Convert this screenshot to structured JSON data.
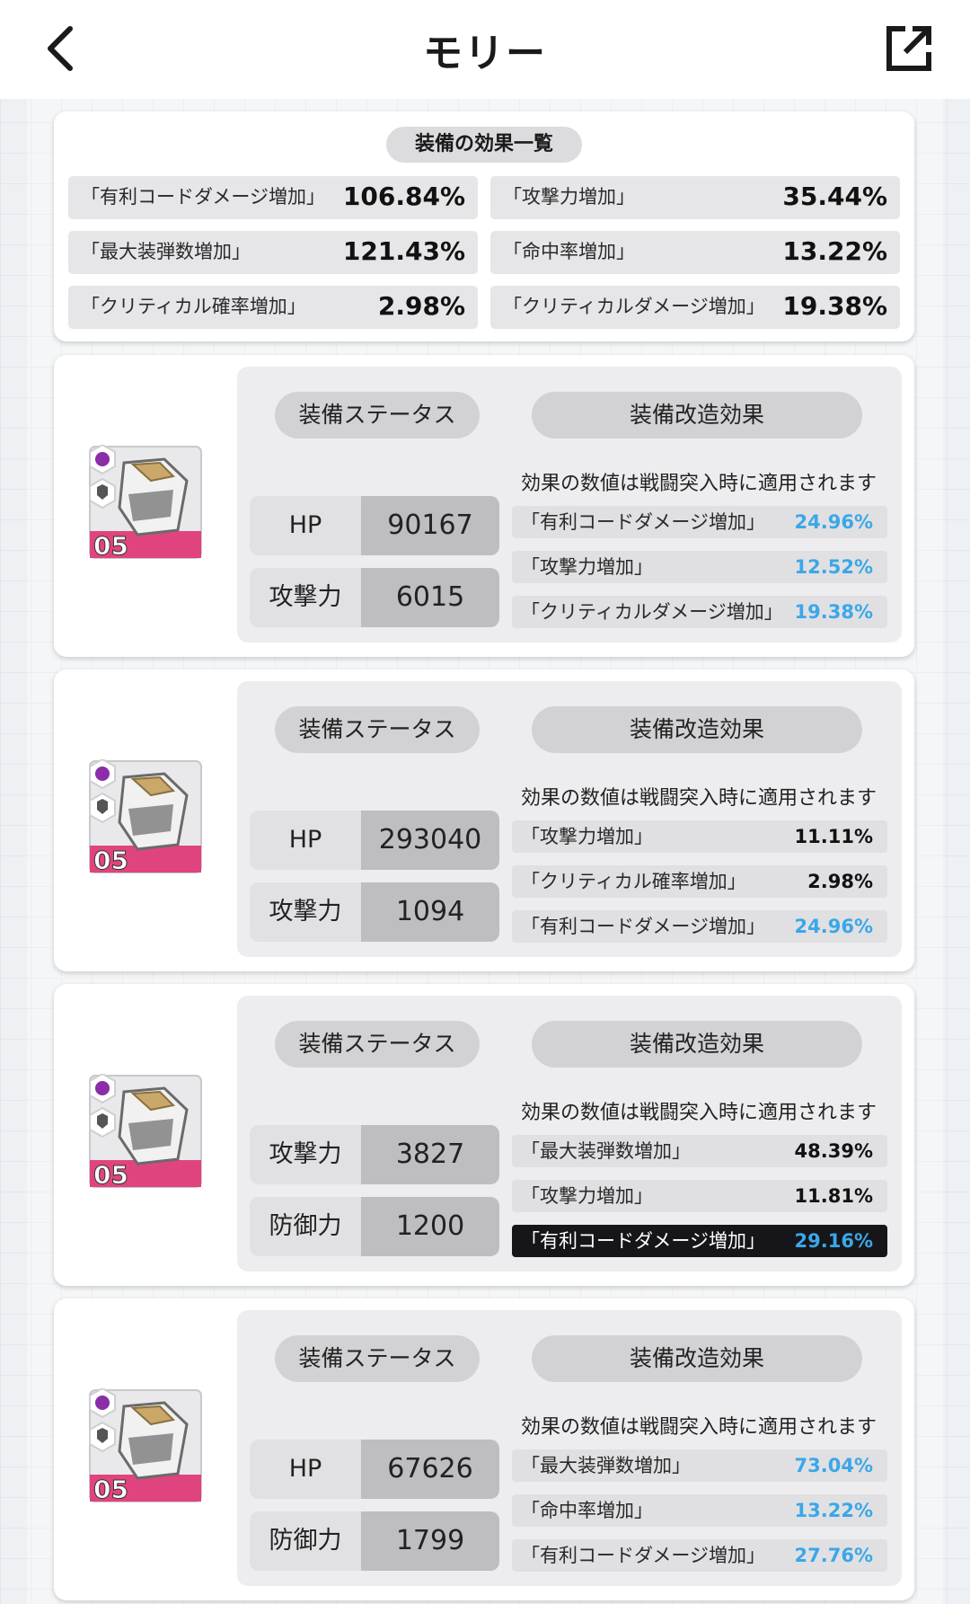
{
  "header": {
    "title": "モリー"
  },
  "summary": {
    "title": "装備の効果一覧",
    "items": [
      {
        "label": "「有利コードダメージ増加」",
        "value": "106.84%"
      },
      {
        "label": "「攻撃力増加」",
        "value": "35.44%"
      },
      {
        "label": "「最大装弾数増加」",
        "value": "121.43%"
      },
      {
        "label": "「命中率増加」",
        "value": "13.22%"
      },
      {
        "label": "「クリティカル確率増加」",
        "value": "2.98%"
      },
      {
        "label": "「クリティカルダメージ増加」",
        "value": "19.38%"
      }
    ]
  },
  "colors": {
    "accent_blue": "#3ba7e8",
    "badge_purple": "#8b2ca8",
    "level_pink": "#e0447e"
  },
  "equipment": [
    {
      "level": "05",
      "status_label": "装備ステータス",
      "mod_label": "装備改造効果",
      "note": "効果の数値は戦闘突入時に適用されます",
      "stats": [
        {
          "key": "HP",
          "value": "90167"
        },
        {
          "key": "攻撃力",
          "value": "6015"
        }
      ],
      "effects": [
        {
          "label": "「有利コードダメージ増加」",
          "value": "24.96%",
          "highlight": "blue"
        },
        {
          "label": "「攻撃力増加」",
          "value": "12.52%",
          "highlight": "blue"
        },
        {
          "label": "「クリティカルダメージ増加」",
          "value": "19.38%",
          "highlight": "blue"
        }
      ]
    },
    {
      "level": "05",
      "status_label": "装備ステータス",
      "mod_label": "装備改造効果",
      "note": "効果の数値は戦闘突入時に適用されます",
      "stats": [
        {
          "key": "HP",
          "value": "293040"
        },
        {
          "key": "攻撃力",
          "value": "1094"
        }
      ],
      "effects": [
        {
          "label": "「攻撃力増加」",
          "value": "11.11%",
          "highlight": "none"
        },
        {
          "label": "「クリティカル確率増加」",
          "value": "2.98%",
          "highlight": "none"
        },
        {
          "label": "「有利コードダメージ増加」",
          "value": "24.96%",
          "highlight": "blue"
        }
      ]
    },
    {
      "level": "05",
      "status_label": "装備ステータス",
      "mod_label": "装備改造効果",
      "note": "効果の数値は戦闘突入時に適用されます",
      "stats": [
        {
          "key": "攻撃力",
          "value": "3827"
        },
        {
          "key": "防御力",
          "value": "1200"
        }
      ],
      "effects": [
        {
          "label": "「最大装弾数増加」",
          "value": "48.39%",
          "highlight": "none"
        },
        {
          "label": "「攻撃力増加」",
          "value": "11.81%",
          "highlight": "none"
        },
        {
          "label": "「有利コードダメージ増加」",
          "value": "29.16%",
          "highlight": "dark"
        }
      ]
    },
    {
      "level": "05",
      "status_label": "装備ステータス",
      "mod_label": "装備改造効果",
      "note": "効果の数値は戦闘突入時に適用されます",
      "stats": [
        {
          "key": "HP",
          "value": "67626"
        },
        {
          "key": "防御力",
          "value": "1799"
        }
      ],
      "effects": [
        {
          "label": "「最大装弾数増加」",
          "value": "73.04%",
          "highlight": "blue"
        },
        {
          "label": "「命中率増加」",
          "value": "13.22%",
          "highlight": "blue"
        },
        {
          "label": "「有利コードダメージ増加」",
          "value": "27.76%",
          "highlight": "blue"
        }
      ]
    }
  ]
}
